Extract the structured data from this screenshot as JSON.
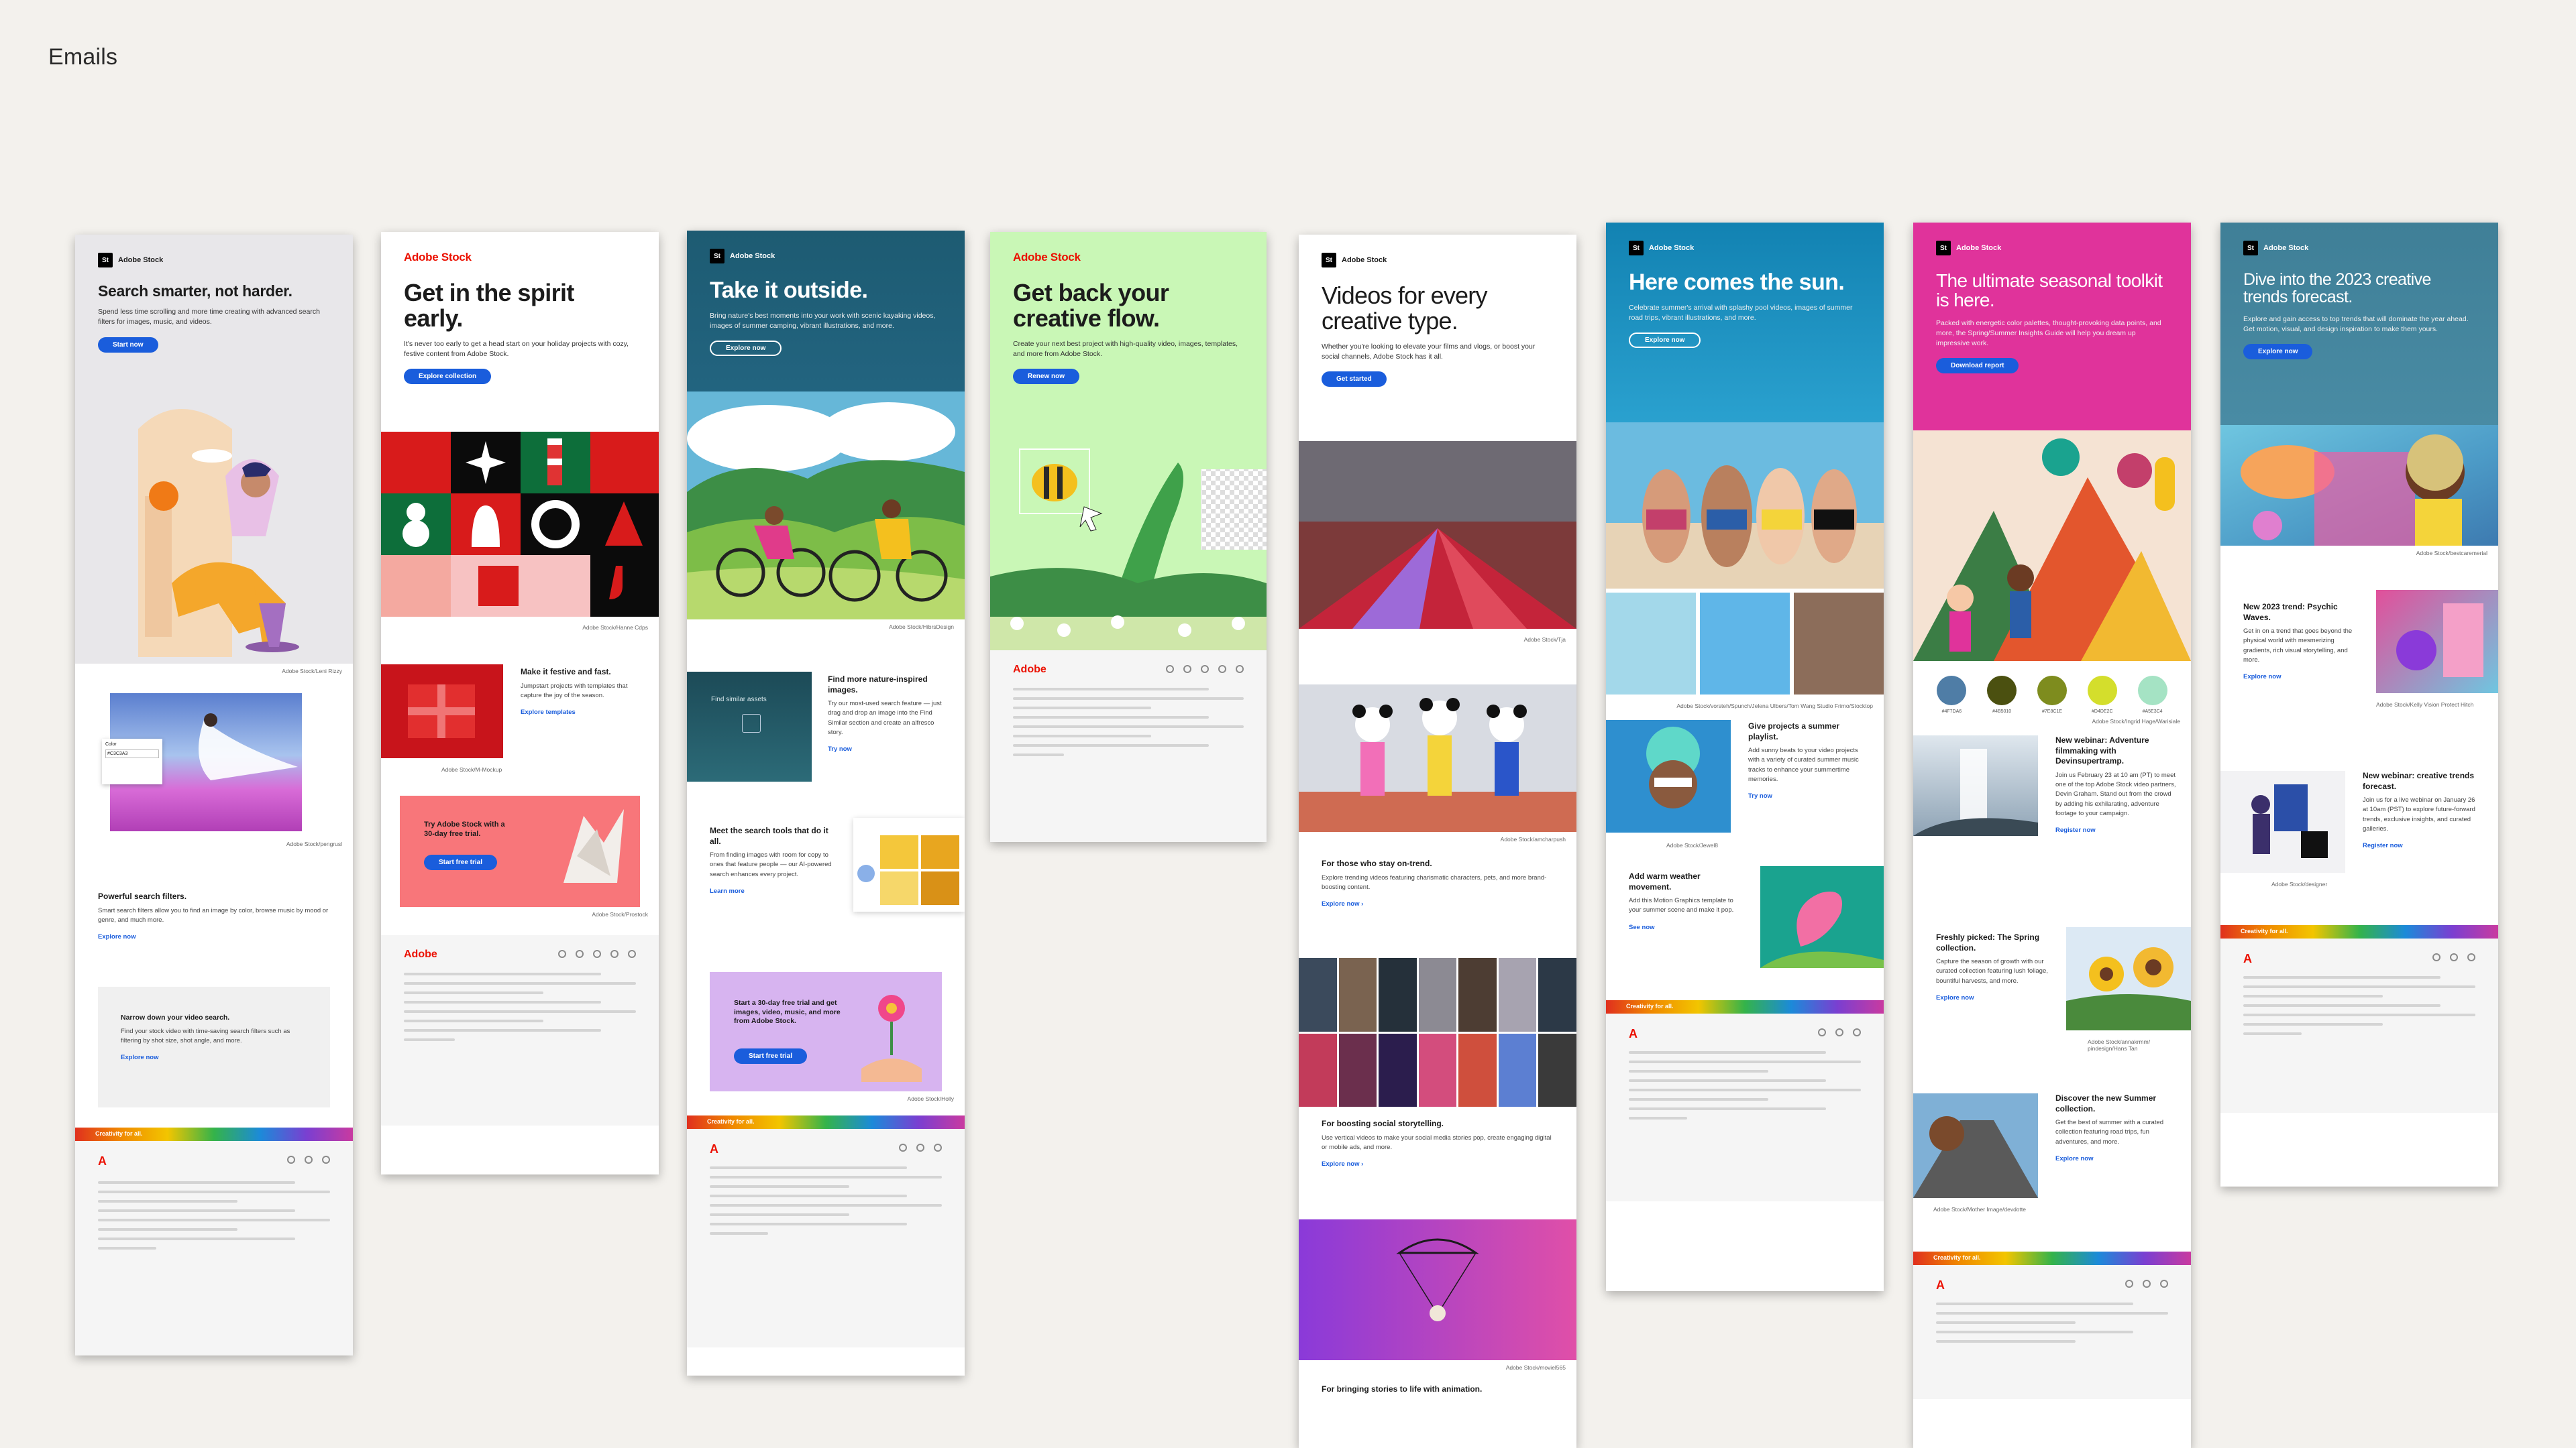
{
  "page": {
    "title": "Emails"
  },
  "emails": [
    {
      "id": "e1",
      "logo": "Adobe Stock",
      "headline": "Search smarter, not harder.",
      "sub": "Spend less time scrolling and more time creating with advanced search filters for images, music, and videos.",
      "cta": "Start now",
      "caption1": "Adobe Stock/Leni Rizzy",
      "caption2": "Adobe Stock/pengrusl",
      "sec1_title": "Powerful search filters.",
      "sec1_body": "Smart search filters allow you to find an image by color, browse music by mood or genre, and much more.",
      "sec1_link": "Explore now",
      "sec2_title": "Narrow down your video search.",
      "sec2_body": "Find your stock video with time-saving search filters such as filtering by shot size, shot angle, and more.",
      "sec2_link": "Explore now",
      "color_label": "Color",
      "color_hex": "#C3C3A3",
      "rainbow": "Creativity for all."
    },
    {
      "id": "e2",
      "logo": "Adobe Stock",
      "headline": "Get in the spirit early.",
      "sub": "It's never too early to get a head start on your holiday projects with cozy, festive content from Adobe Stock.",
      "cta": "Explore collection",
      "caption1": "Adobe Stock/Hanne Cdps",
      "sec1_title": "Make it festive and fast.",
      "sec1_body": "Jumpstart projects with templates that capture the joy of the season.",
      "sec1_link": "Explore templates",
      "caption2": "Adobe Stock/M-Mockup",
      "promo_title": "Try Adobe Stock with a 30-day free trial.",
      "promo_cta": "Start free trial",
      "caption3": "Adobe Stock/Prostock",
      "footer_logo": "Adobe"
    },
    {
      "id": "e3",
      "logo": "Adobe Stock",
      "headline": "Take it outside.",
      "sub": "Bring nature's best moments into your work with scenic kayaking videos, images of summer camping, vibrant illustrations, and more.",
      "cta": "Explore now",
      "caption1": "Adobe Stock/HibrsDesign",
      "similar": "Find similar assets",
      "sec1_title": "Find more nature-inspired images.",
      "sec1_body": "Try our most-used search feature — just drag and drop an image into the Find Similar section and create an alfresco story.",
      "sec1_link": "Try now",
      "sec2_title": "Meet the search tools that do it all.",
      "sec2_body": "From finding images with room for copy to ones that feature people — our AI-powered search enhances every project.",
      "sec2_link": "Learn more",
      "promo_title": "Start a 30-day free trial and get images, video, music, and more from Adobe Stock.",
      "promo_cta": "Start free trial",
      "caption2": "Adobe Stock/Holly",
      "rainbow": "Creativity for all."
    },
    {
      "id": "e4",
      "logo": "Adobe Stock",
      "headline": "Get back your creative flow.",
      "sub": "Create your next best project with high-quality video, images, templates, and more from Adobe Stock.",
      "cta": "Renew now",
      "footer_logo": "Adobe"
    },
    {
      "id": "e5",
      "logo": "Adobe Stock",
      "headline": "Videos for every creative type.",
      "sub": "Whether you're looking to elevate your films and vlogs, or boost your social channels, Adobe Stock has it all.",
      "cta": "Get started",
      "caption1": "Adobe Stock/Tja",
      "caption2": "Adobe Stock/amcharpush",
      "sec1_title": "For those who stay on-trend.",
      "sec1_body": "Explore trending videos featuring charismatic characters, pets, and more brand-boosting content.",
      "sec1_link": "Explore now ›",
      "sec2_title": "For boosting social storytelling.",
      "sec2_body": "Use vertical videos to make your social media stories pop, create engaging digital or mobile ads, and more.",
      "sec2_link": "Explore now ›",
      "caption3": "Adobe Stock/moviel565",
      "sec3_title": "For bringing stories to life with animation."
    },
    {
      "id": "e6",
      "logo": "Adobe Stock",
      "headline": "Here comes the sun.",
      "sub": "Celebrate summer's arrival with splashy pool videos, images of summer road trips, vibrant illustrations, and more.",
      "cta": "Explore now",
      "caption1": "Adobe Stock/vorsteh/Spunch/Jelena Ulbers/Tom Wang Studio Frimo/Stocktop",
      "sec1_title": "Give projects a summer playlist.",
      "sec1_body": "Add sunny beats to your video projects with a variety of curated summer music tracks to enhance your summertime memories.",
      "sec1_link": "Try now",
      "caption2": "Adobe Stock/Jewel8",
      "sec2_title": "Add warm weather movement.",
      "sec2_body": "Add this Motion Graphics template to your summer scene and make it pop.",
      "sec2_link": "See now",
      "rainbow": "Creativity for all."
    },
    {
      "id": "e7",
      "logo": "Adobe Stock",
      "headline": "The ultimate seasonal toolkit is here.",
      "sub": "Packed with energetic color palettes, thought-provoking data points, and more, the Spring/Summer Insights Guide will help you dream up impressive work.",
      "cta": "Download report",
      "swatches": [
        {
          "hex": "#4F7DA6",
          "label": "#4F7DA6"
        },
        {
          "hex": "#4B5010",
          "label": "#4B5010"
        },
        {
          "hex": "#7E8C1E",
          "label": "#7E8C1E"
        },
        {
          "hex": "#D4DE2C",
          "label": "#D4DE2C"
        },
        {
          "hex": "#A5E3C4",
          "label": "#A5E3C4"
        }
      ],
      "caption1": "Adobe Stock/Ingrid Hage/Warisiale",
      "sec1_title": "New webinar: Adventure filmmaking with Devinsupertramp.",
      "sec1_body": "Join us February 23 at 10 am (PT) to meet one of the top Adobe Stock video partners, Devin Graham. Stand out from the crowd by adding his exhilarating, adventure footage to your campaign.",
      "sec1_link": "Register now",
      "sec2_title": "Freshly picked: The Spring collection.",
      "sec2_body": "Capture the season of growth with our curated collection featuring lush foliage, bountiful harvests, and more.",
      "sec2_link": "Explore now",
      "caption2": "Adobe Stock/annakrmm/ pindesign/Hans Tan",
      "sec3_title": "Discover the new Summer collection.",
      "sec3_body": "Get the best of summer with a curated collection featuring road trips, fun adventures, and more.",
      "sec3_link": "Explore now",
      "caption3": "Adobe Stock/Mother Image/devdotte",
      "rainbow": "Creativity for all."
    },
    {
      "id": "e8",
      "logo": "Adobe Stock",
      "headline": "Dive into the 2023 creative trends forecast.",
      "sub": "Explore and gain access to top trends that will dominate the year ahead. Get motion, visual, and design inspiration to make them yours.",
      "cta": "Explore now",
      "caption1": "Adobe Stock/bestcaremerial",
      "sec1_title": "New 2023 trend: Psychic Waves.",
      "sec1_body": "Get in on a trend that goes beyond the physical world with mesmerizing gradients, rich visual storytelling, and more.",
      "sec1_link": "Explore now",
      "caption2": "Adobe Stock/Kelly Vision Protect Hitch",
      "sec2_title": "New webinar: creative trends forecast.",
      "sec2_body": "Join us for a live webinar on January 26 at 10am (PST) to explore future-forward trends, exclusive insights, and curated galleries.",
      "sec2_link": "Register now",
      "caption3": "Adobe Stock/designer",
      "rainbow": "Creativity for all."
    }
  ]
}
